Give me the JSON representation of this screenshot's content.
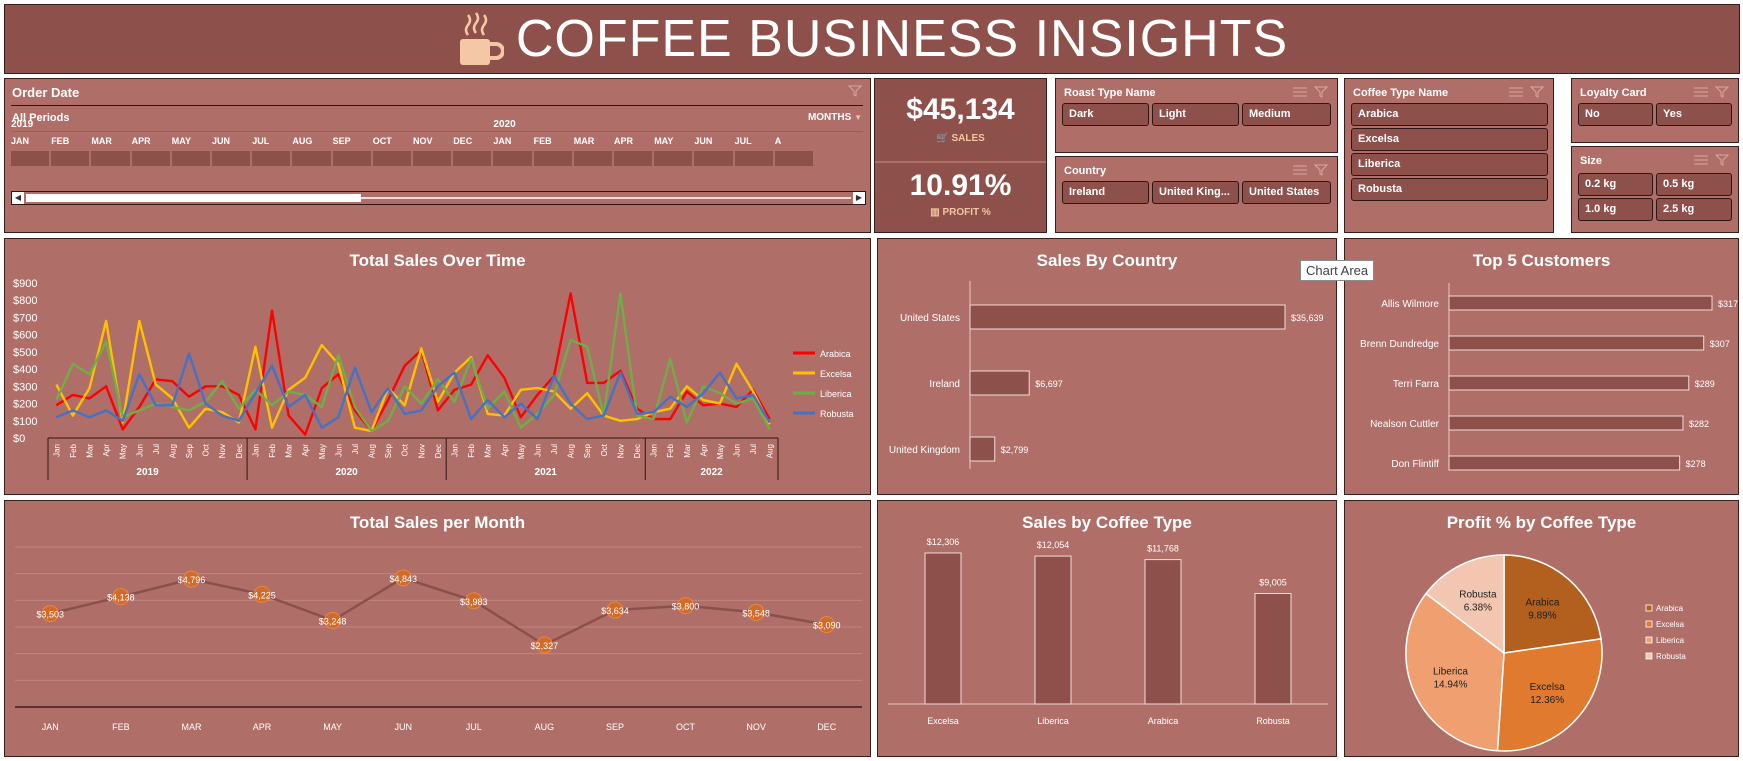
{
  "header": {
    "title": "COFFEE BUSINESS INSIGHTS",
    "icon": "coffee-cup-icon"
  },
  "timeline": {
    "title": "Order Date",
    "periods_label": "All Periods",
    "unit_label": "MONTHS",
    "years": [
      "2019",
      "2020"
    ],
    "months": [
      "JAN",
      "FEB",
      "MAR",
      "APR",
      "MAY",
      "JUN",
      "JUL",
      "AUG",
      "SEP",
      "OCT",
      "NOV",
      "DEC",
      "JAN",
      "FEB",
      "MAR",
      "APR",
      "MAY",
      "JUN",
      "JUL",
      "A"
    ]
  },
  "kpi": {
    "sales_value": "$45,134",
    "sales_label": "SALES",
    "profit_value": "10.91%",
    "profit_label": "PROFIT %"
  },
  "slicers": {
    "roast": {
      "title": "Roast Type Name",
      "items": [
        "Dark",
        "Light",
        "Medium"
      ]
    },
    "country": {
      "title": "Country",
      "items": [
        "Ireland",
        "United King...",
        "United States"
      ]
    },
    "coffee_type": {
      "title": "Coffee Type Name",
      "items": [
        "Arabica",
        "Excelsa",
        "Liberica",
        "Robusta"
      ]
    },
    "loyalty": {
      "title": "Loyalty Card",
      "items": [
        "No",
        "Yes"
      ]
    },
    "size": {
      "title": "Size",
      "items": [
        "0.2 kg",
        "0.5 kg",
        "1.0 kg",
        "2.5 kg"
      ]
    }
  },
  "tooltip": {
    "text": "Chart Area"
  },
  "colors": {
    "panel": "#b06e68",
    "dark": "#8e504b",
    "arabica": "#ff0000",
    "excelsa": "#ffc000",
    "liberica": "#70ad47",
    "robusta": "#4472c4"
  },
  "chart_data": [
    {
      "type": "line",
      "title": "Total Sales Over Time",
      "y_ticks": [
        "$900",
        "$800",
        "$700",
        "$600",
        "$500",
        "$400",
        "$300",
        "$200",
        "$100",
        "$0"
      ],
      "ylim": [
        0,
        900
      ],
      "month_labels": [
        "Jan",
        "Feb",
        "Mar",
        "Apr",
        "May",
        "Jun",
        "Jul",
        "Aug",
        "Sep",
        "Oct",
        "Nov",
        "Dec"
      ],
      "years": [
        "2019",
        "2020",
        "2021",
        "2022"
      ],
      "series": [
        {
          "name": "Arabica",
          "color": "#ff0000",
          "values": [
            190,
            250,
            230,
            300,
            50,
            180,
            340,
            330,
            240,
            300,
            300,
            250,
            50,
            740,
            130,
            20,
            290,
            370,
            160,
            40,
            220,
            420,
            510,
            160,
            280,
            310,
            480,
            350,
            120,
            250,
            360,
            840,
            320,
            320,
            390,
            170,
            110,
            110,
            270,
            190,
            200,
            180,
            280,
            110
          ]
        },
        {
          "name": "Excelsa",
          "color": "#ffc000",
          "values": [
            310,
            130,
            290,
            680,
            90,
            680,
            310,
            230,
            60,
            170,
            150,
            90,
            530,
            60,
            280,
            350,
            540,
            430,
            60,
            40,
            290,
            190,
            520,
            210,
            380,
            470,
            140,
            130,
            280,
            290,
            270,
            170,
            260,
            130,
            100,
            110,
            150,
            170,
            300,
            220,
            200,
            430,
            270,
            80
          ]
        },
        {
          "name": "Liberica",
          "color": "#70ad47",
          "values": [
            220,
            430,
            370,
            560,
            120,
            160,
            200,
            180,
            160,
            210,
            330,
            170,
            280,
            190,
            270,
            250,
            180,
            480,
            180,
            40,
            100,
            300,
            200,
            340,
            210,
            460,
            170,
            270,
            60,
            140,
            250,
            570,
            530,
            130,
            840,
            130,
            110,
            460,
            90,
            300,
            260,
            200,
            230,
            50
          ]
        },
        {
          "name": "Robusta",
          "color": "#4472c4",
          "values": [
            120,
            160,
            120,
            160,
            100,
            370,
            190,
            190,
            490,
            200,
            130,
            100,
            260,
            420,
            180,
            250,
            60,
            120,
            410,
            150,
            290,
            140,
            160,
            300,
            380,
            110,
            220,
            120,
            200,
            110,
            360,
            200,
            110,
            130,
            380,
            140,
            150,
            240,
            180,
            260,
            380,
            230,
            250,
            90
          ]
        }
      ]
    },
    {
      "type": "bar",
      "title": "Sales By Country",
      "categories": [
        "United States",
        "Ireland",
        "United Kingdom"
      ],
      "values": [
        35639,
        6697,
        2799
      ],
      "labels": [
        "$35,639",
        "$6,697",
        "$2,799"
      ]
    },
    {
      "type": "bar",
      "title": "Top 5 Customers",
      "categories": [
        "Allis Wilmore",
        "Brenn Dundredge",
        "Terri Farra",
        "Nealson Cuttler",
        "Don Flintiff"
      ],
      "values": [
        317,
        307,
        289,
        282,
        278
      ],
      "labels": [
        "$317",
        "$307",
        "$289",
        "$282",
        "$278"
      ]
    },
    {
      "type": "line",
      "title": "Total Sales per Month",
      "categories": [
        "JAN",
        "FEB",
        "MAR",
        "APR",
        "MAY",
        "JUN",
        "JUL",
        "AUG",
        "SEP",
        "OCT",
        "NOV",
        "DEC"
      ],
      "values": [
        3503,
        4138,
        4796,
        4225,
        3248,
        4843,
        3983,
        2327,
        3634,
        3800,
        3548,
        3090
      ],
      "labels": [
        "$3,503",
        "$4,138",
        "$4,796",
        "$4,225",
        "$3,248",
        "$4,843",
        "$3,983",
        "$2,327",
        "$3,634",
        "$3,800",
        "$3,548",
        "$3,090"
      ]
    },
    {
      "type": "bar",
      "title": "Sales by Coffee Type",
      "categories": [
        "Excelsa",
        "Liberica",
        "Arabica",
        "Robusta"
      ],
      "values": [
        12306,
        12054,
        11768,
        9005
      ],
      "labels": [
        "$12,306",
        "$12,054",
        "$11,768",
        "$9,005"
      ]
    },
    {
      "type": "pie",
      "title": "Profit % by Coffee Type",
      "categories": [
        "Arabica",
        "Excelsa",
        "Liberica",
        "Robusta"
      ],
      "values": [
        9.89,
        12.36,
        14.94,
        6.38
      ],
      "labels": [
        "9.89%",
        "12.36%",
        "14.94%",
        "6.38%"
      ],
      "colors": [
        "#b3601f",
        "#e07a2e",
        "#f0a070",
        "#f3c6b2"
      ],
      "legend": "right"
    }
  ]
}
